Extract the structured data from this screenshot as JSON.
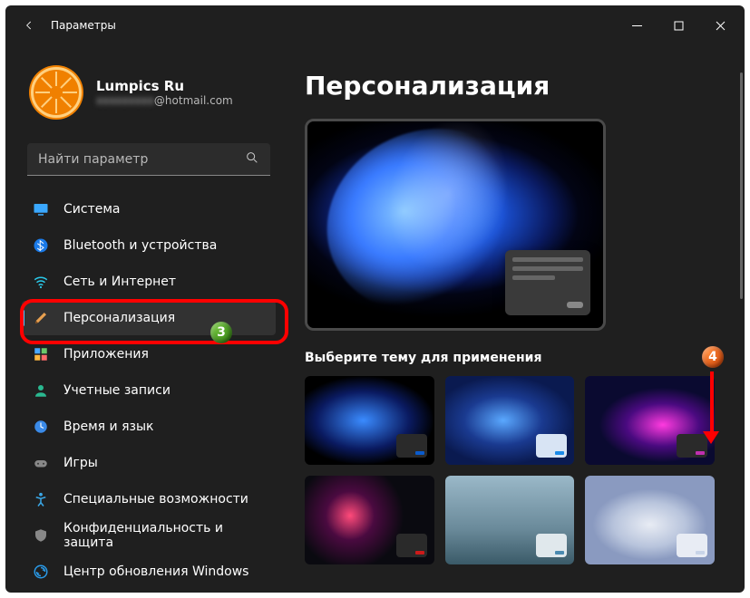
{
  "window_title": "Параметры",
  "profile": {
    "name": "Lumpics Ru",
    "email_hidden": "xxxxxxxxx",
    "email_domain": "@hotmail.com"
  },
  "search": {
    "placeholder": "Найти параметр"
  },
  "nav": {
    "items": [
      {
        "label": "Система"
      },
      {
        "label": "Bluetooth и устройства"
      },
      {
        "label": "Сеть и Интернет"
      },
      {
        "label": "Персонализация"
      },
      {
        "label": "Приложения"
      },
      {
        "label": "Учетные записи"
      },
      {
        "label": "Время и язык"
      },
      {
        "label": "Игры"
      },
      {
        "label": "Специальные возможности"
      },
      {
        "label": "Конфиденциальность и защита"
      },
      {
        "label": "Центр обновления Windows"
      }
    ],
    "active_index": 3
  },
  "page_title": "Персонализация",
  "theme_section_label": "Выберите тему для применения",
  "themes": [
    {
      "name": "dark-blue-bloom",
      "card_bg": "#2a2a2a",
      "accent": "#0a5bcc"
    },
    {
      "name": "blue-bloom-light",
      "card_bg": "#d8e4f4",
      "accent": "#1a8ae8"
    },
    {
      "name": "purple-glow",
      "card_bg": "#2a2a2a",
      "accent": "#c030b0"
    },
    {
      "name": "flower-dark",
      "card_bg": "#2a2a2a",
      "accent": "#cc1a1a"
    },
    {
      "name": "seascape-light",
      "card_bg": "#e0e8ec",
      "accent": "#4a8ab0"
    },
    {
      "name": "light-bloom",
      "card_bg": "#e8ecf4",
      "accent": "#c8d4e8"
    }
  ],
  "annotations": {
    "badge3": "3",
    "badge4": "4"
  },
  "colors": {
    "accent": "#0078d4",
    "orange": "#f08000",
    "red": "#ff0000"
  }
}
